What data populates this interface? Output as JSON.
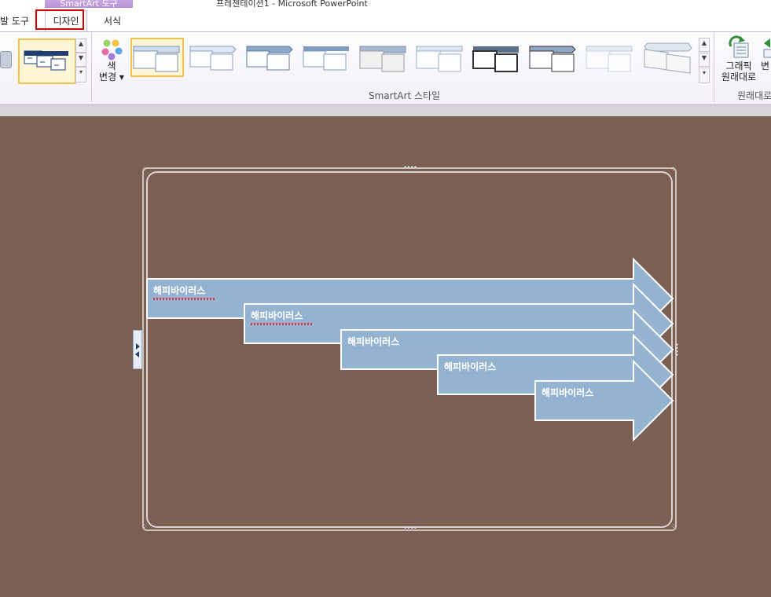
{
  "window": {
    "title": "프레젠테이션1 - Microsoft PowerPoint"
  },
  "context_band": {
    "label": "SmartArt 도구"
  },
  "tabs": [
    {
      "label": "발 도구"
    },
    {
      "label": "디자인"
    },
    {
      "label": "서식"
    }
  ],
  "ribbon": {
    "color_button": {
      "line1": "색",
      "line2": "변경 ▾"
    },
    "smartart_styles_label": "SmartArt 스타일",
    "reset_button": {
      "line1": "그래픽",
      "line2": "원래대로"
    },
    "reset_group_label": "원래대로",
    "convert_partial": "변"
  },
  "diagram": {
    "items": [
      {
        "text": "해피바이러스"
      },
      {
        "text": "해피바이러스"
      },
      {
        "text": "해피바이러스"
      },
      {
        "text": "해피바이러스"
      },
      {
        "text": "해피바이러스"
      }
    ],
    "fill": "#94b3d1",
    "stroke": "#ffffff"
  },
  "colors": {
    "background": "#7a5f52",
    "accent": "#b88fd8",
    "highlight": "#d40000"
  }
}
